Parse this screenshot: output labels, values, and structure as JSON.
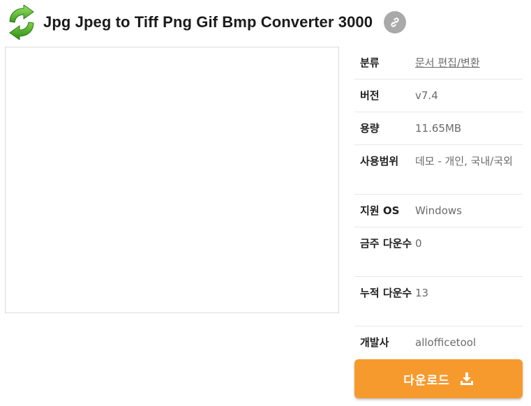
{
  "app": {
    "title": "Jpg Jpeg to Tiff Png Gif Bmp Converter 3000",
    "icon": "recycle-arrows-icon",
    "link_icon": "link-icon"
  },
  "info": {
    "rows": [
      {
        "label": "분류",
        "value": "문서 편집/변환",
        "is_link": true
      },
      {
        "label": "버전",
        "value": "v7.4"
      },
      {
        "label": "용량",
        "value": "11.65MB"
      },
      {
        "label": "사용범위",
        "value": "데모 - 개인, 국내/국외"
      },
      {
        "label": "지원 OS",
        "value": "Windows"
      },
      {
        "label": "금주 다운수",
        "value": "0"
      },
      {
        "label": "누적 다운수",
        "value": "13"
      },
      {
        "label": "개발사",
        "value": "allofficetool"
      }
    ]
  },
  "download": {
    "label": "다운로드",
    "icon": "download-icon"
  },
  "colors": {
    "accent": "#f79a2e",
    "link_button_bg": "#a9a9a9",
    "icon_green": "#4cae2b"
  }
}
